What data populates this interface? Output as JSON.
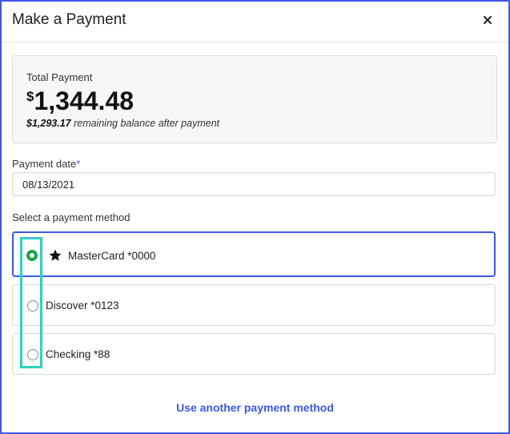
{
  "dialog": {
    "title": "Make a Payment",
    "close_icon": "close-icon"
  },
  "summary": {
    "label": "Total Payment",
    "currency_symbol": "$",
    "amount": "1,344.48",
    "remaining_amount": "$1,293.17",
    "remaining_text": " remaining balance after payment"
  },
  "payment_date": {
    "label": "Payment date",
    "required_marker": "*",
    "value": "08/13/2021"
  },
  "payment_method": {
    "label": "Select a payment method",
    "options": [
      {
        "label": "MasterCard *0000",
        "selected": true,
        "icon": "star-icon"
      },
      {
        "label": "Discover *0123",
        "selected": false
      },
      {
        "label": "Checking *88",
        "selected": false
      }
    ]
  },
  "footer": {
    "link_label": "Use another payment method"
  },
  "colors": {
    "accent": "#3d56e6",
    "selected_radio": "#1aa34a",
    "highlight_box": "#2fd1bf"
  }
}
